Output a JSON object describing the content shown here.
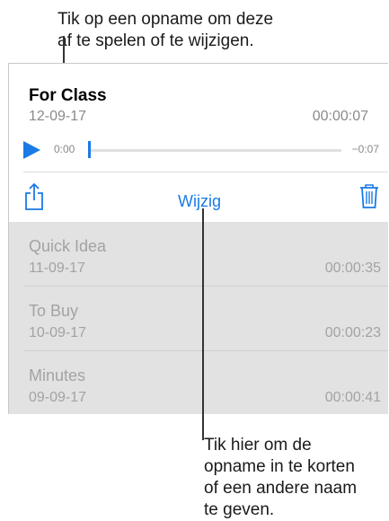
{
  "callouts": {
    "top": [
      "Tik op een opname om deze",
      "af te spelen of te wijzigen."
    ],
    "bottom": [
      "Tik hier om de",
      "opname in te korten",
      "of een andere naam",
      "te geven."
    ]
  },
  "selected_recording": {
    "title": "For Class",
    "date": "12-09-17",
    "duration": "00:00:07",
    "time_elapsed": "0:00",
    "time_remaining": "−0:07",
    "progress": 0.0
  },
  "actions": {
    "share_icon": "share-icon",
    "edit_label": "Wijzig",
    "trash_icon": "trash-icon"
  },
  "colors": {
    "accent": "#1a7ae6",
    "list_background": "#e2e2e2",
    "muted_text": "#a3a3a3"
  },
  "recordings": [
    {
      "title": "Quick Idea",
      "date": "11-09-17",
      "duration": "00:00:35"
    },
    {
      "title": "To Buy",
      "date": "10-09-17",
      "duration": "00:00:23"
    },
    {
      "title": "Minutes",
      "date": "09-09-17",
      "duration": "00:00:41"
    }
  ]
}
